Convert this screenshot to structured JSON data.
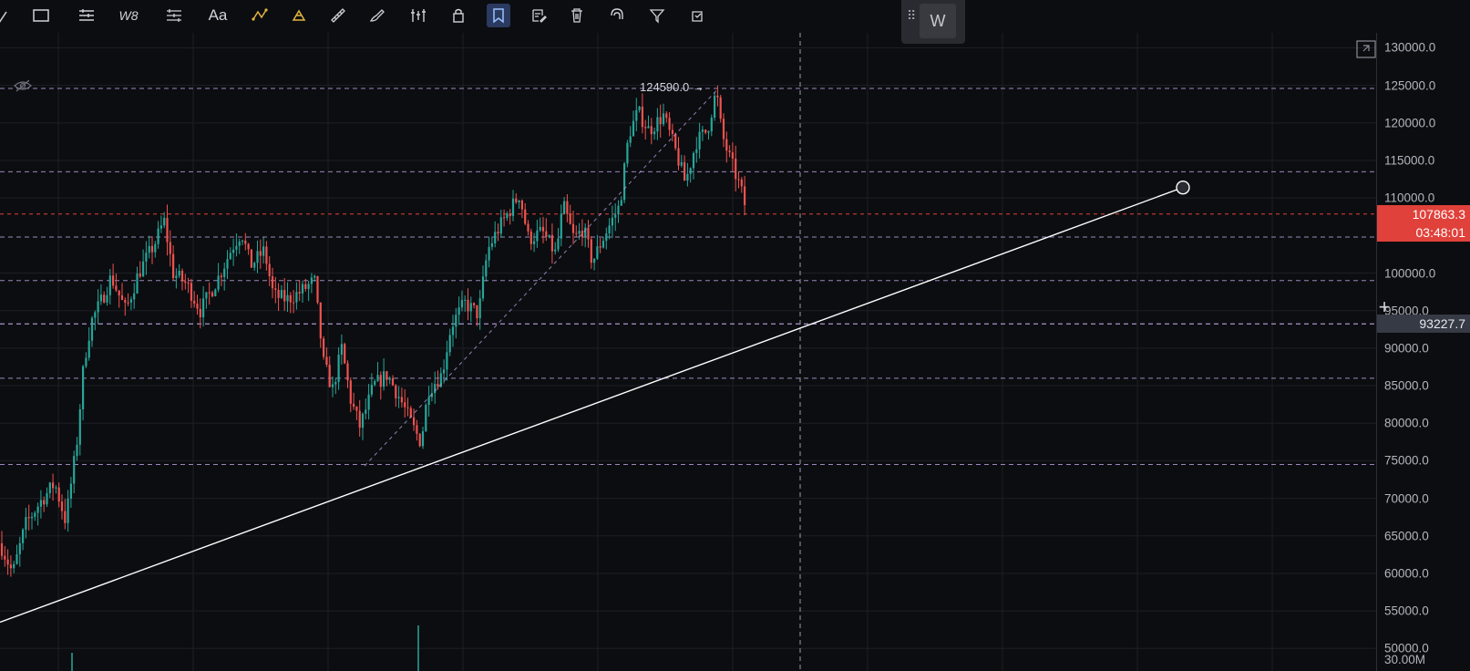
{
  "toolbar": {
    "tools": [
      {
        "name": "trendline-tool-icon"
      },
      {
        "name": "rectangle-tool-icon"
      },
      {
        "name": "fib-retracement-icon"
      },
      {
        "name": "elliott-wave-icon",
        "glyph": "W8"
      },
      {
        "name": "forecast-tool-icon"
      },
      {
        "name": "text-tool-icon",
        "glyph": "Aa"
      },
      {
        "name": "pattern-tool-icon"
      },
      {
        "name": "prediction-tool-icon"
      },
      {
        "name": "ruler-measure-icon"
      },
      {
        "name": "brush-tool-icon"
      },
      {
        "name": "bar-pattern-icon"
      },
      {
        "name": "lock-object-icon"
      },
      {
        "name": "bookmark-icon"
      },
      {
        "name": "edit-note-icon"
      },
      {
        "name": "trash-icon"
      },
      {
        "name": "magnet-icon"
      },
      {
        "name": "filter-icon"
      },
      {
        "name": "sync-drawing-icon"
      }
    ]
  },
  "float_panel": {
    "button_glyph": "W"
  },
  "price_axis": {
    "ticks": [
      "130000.0",
      "125000.0",
      "120000.0",
      "115000.0",
      "110000.0",
      "100000.0",
      "95000.0",
      "90000.0",
      "85000.0",
      "80000.0",
      "75000.0",
      "70000.0",
      "65000.0",
      "60000.0",
      "55000.0",
      "50000.0"
    ],
    "current_price": "107863.3",
    "countdown": "03:48:01",
    "crosshair_price": "93227.7",
    "volume_label": "30.00M"
  },
  "annotations": {
    "high_label": "124590.0"
  },
  "colors": {
    "bull": "#26a69a",
    "bear": "#ef5350",
    "price_line": "#e0413a",
    "level_line": "#b39ddb",
    "trendline": "#ffffff"
  },
  "chart_data": {
    "type": "candlestick",
    "y_axis": {
      "min": 47000,
      "max": 132000
    },
    "horizontal_levels": [
      124590,
      113500,
      104800,
      99000,
      93227.7,
      86000,
      74500
    ],
    "high_marker": 124590,
    "trendline": {
      "from": [
        0,
        53500
      ],
      "to": [
        1298,
        111400
      ]
    },
    "close_path": [
      [
        0,
        64000
      ],
      [
        14,
        60000
      ],
      [
        28,
        66500
      ],
      [
        44,
        69500
      ],
      [
        60,
        72000
      ],
      [
        72,
        67000
      ],
      [
        84,
        77000
      ],
      [
        92,
        88000
      ],
      [
        100,
        93500
      ],
      [
        112,
        96500
      ],
      [
        122,
        99500
      ],
      [
        138,
        95000
      ],
      [
        152,
        100000
      ],
      [
        170,
        104000
      ],
      [
        180,
        107000
      ],
      [
        190,
        100000
      ],
      [
        205,
        98500
      ],
      [
        220,
        95000
      ],
      [
        240,
        99500
      ],
      [
        255,
        103500
      ],
      [
        265,
        105500
      ],
      [
        275,
        101000
      ],
      [
        290,
        103000
      ],
      [
        300,
        97000
      ],
      [
        315,
        96500
      ],
      [
        330,
        97500
      ],
      [
        345,
        99000
      ],
      [
        355,
        88000
      ],
      [
        365,
        84500
      ],
      [
        375,
        90000
      ],
      [
        385,
        83000
      ],
      [
        395,
        79500
      ],
      [
        410,
        85000
      ],
      [
        425,
        86500
      ],
      [
        440,
        83000
      ],
      [
        455,
        79000
      ],
      [
        462,
        77500
      ],
      [
        470,
        84500
      ],
      [
        485,
        86500
      ],
      [
        495,
        93000
      ],
      [
        510,
        96000
      ],
      [
        525,
        94500
      ],
      [
        535,
        103000
      ],
      [
        545,
        105500
      ],
      [
        560,
        108500
      ],
      [
        570,
        110500
      ],
      [
        580,
        104500
      ],
      [
        595,
        105500
      ],
      [
        610,
        102500
      ],
      [
        618,
        109000
      ],
      [
        630,
        104500
      ],
      [
        640,
        106000
      ],
      [
        650,
        101500
      ],
      [
        665,
        105500
      ],
      [
        680,
        109000
      ],
      [
        690,
        118500
      ],
      [
        700,
        121500
      ],
      [
        712,
        119000
      ],
      [
        728,
        121000
      ],
      [
        742,
        116000
      ],
      [
        752,
        112000
      ],
      [
        764,
        117500
      ],
      [
        776,
        119000
      ],
      [
        786,
        124300
      ],
      [
        792,
        118500
      ],
      [
        800,
        115500
      ],
      [
        812,
        111500
      ],
      [
        820,
        107863
      ]
    ]
  }
}
